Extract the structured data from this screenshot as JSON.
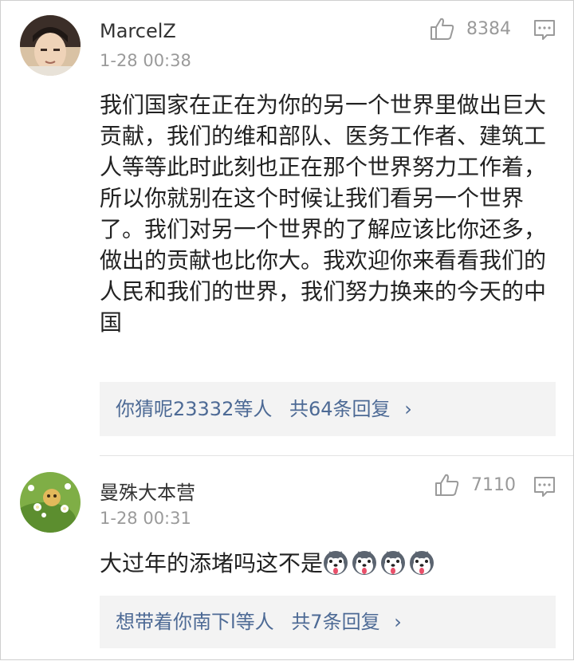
{
  "comments": [
    {
      "username": "MarcelZ",
      "time": "1-28 00:38",
      "likes": "8384",
      "content": "我们国家在正在为你的另一个世界里做出巨大贡献，我们的维和部队、医务工作者、建筑工人等等此时此刻也正在那个世界努力工作着，所以你就别在这个时候让我们看另一个世界了。我们对另一个世界的了解应该比你还多，做出的贡献也比你大。我欢迎你来看看我们的人民和我们的世界，我们努力换来的今天的中国",
      "replies": {
        "names": "你猜呢23332等人",
        "count": "共64条回复",
        "chevron": "›"
      }
    },
    {
      "username": "曼殊大本营",
      "time": "1-28 00:31",
      "likes": "7110",
      "content": "大过年的添堵吗这不是",
      "emojis": [
        "husky-face-emoji",
        "husky-face-emoji",
        "husky-face-emoji",
        "husky-face-emoji"
      ],
      "replies": {
        "names": "想带着你南下l等人",
        "count": "共7条回复",
        "chevron": "›"
      }
    }
  ],
  "icons": {
    "like": "thumbs-up-icon",
    "reply": "comment-bubble-icon"
  },
  "colors": {
    "link": "#4d6a95",
    "meta": "#9a9a9a",
    "replies_bg": "#f3f3f3"
  }
}
